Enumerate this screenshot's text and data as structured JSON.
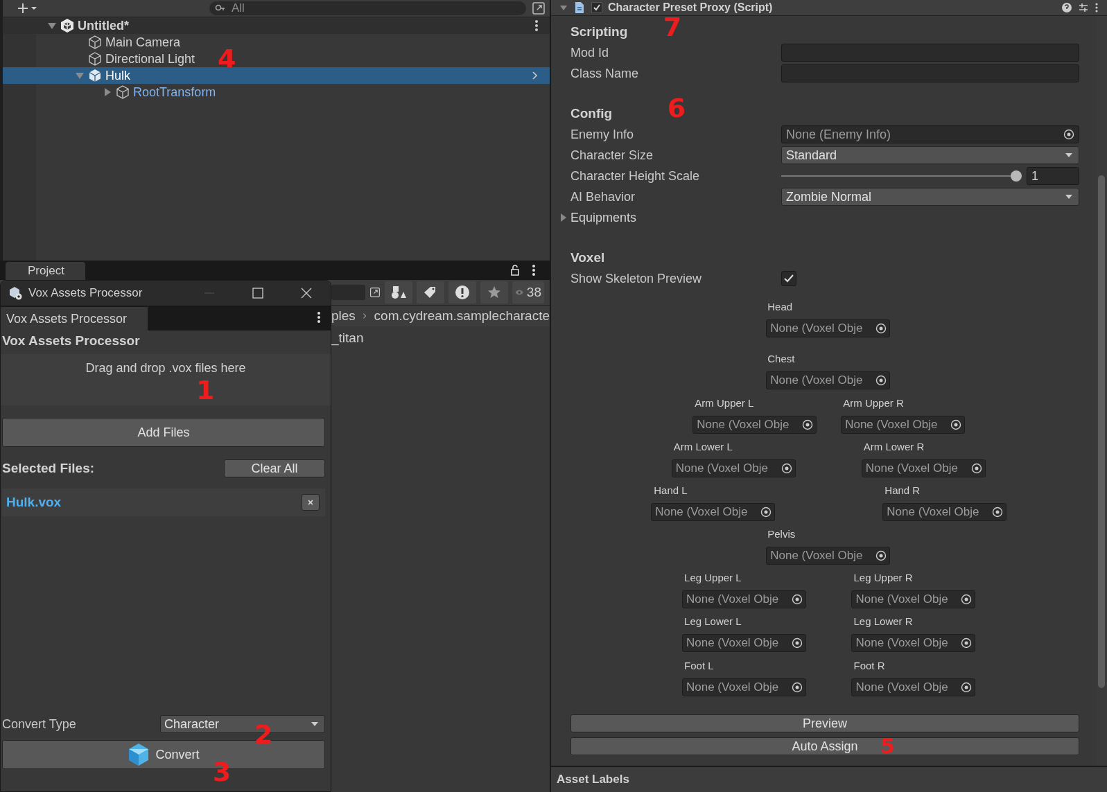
{
  "hierarchy": {
    "search": {
      "placeholder": "All"
    },
    "items": [
      {
        "label": "Untitled*",
        "kind": "scene",
        "expanded": true,
        "selected": false,
        "children": [
          {
            "label": "Main Camera",
            "kind": "object",
            "selected": false
          },
          {
            "label": "Directional Light",
            "kind": "object",
            "selected": false
          },
          {
            "label": "Hulk",
            "kind": "prefab",
            "expanded": true,
            "selected": true,
            "children": [
              {
                "label": "RootTransform",
                "kind": "prefab",
                "expanded": false,
                "selected": false
              }
            ]
          }
        ]
      }
    ]
  },
  "project": {
    "tab": "Project",
    "visible_count": "38",
    "breadcrumb": [
      "ples",
      "com.cydream.samplecharacte"
    ],
    "items": [
      "_titan"
    ]
  },
  "vox_window": {
    "title": "Vox Assets Processor",
    "tab": "Vox Assets Processor",
    "heading": "Vox Assets Processor",
    "drop_hint": "Drag and drop .vox files here",
    "add_button": "Add Files",
    "selected_label": "Selected Files:",
    "clear_button": "Clear All",
    "files": [
      "Hulk.vox"
    ],
    "convert_type": {
      "label": "Convert Type",
      "value": "Character"
    },
    "convert_button": "Convert"
  },
  "inspector": {
    "component": {
      "title": "Character Preset Proxy (Script)",
      "enabled": true
    },
    "sections": [
      {
        "title": "Scripting",
        "rows": [
          {
            "kind": "text",
            "label": "Mod Id"
          },
          {
            "kind": "text",
            "label": "Class Name"
          }
        ]
      },
      {
        "title": "Config",
        "rows": [
          {
            "kind": "object",
            "label": "Enemy Info",
            "value": "None (Enemy Info)"
          },
          {
            "kind": "dropdown",
            "label": "Character Size",
            "value": "Standard"
          },
          {
            "kind": "slider",
            "label": "Character Height Scale",
            "value": "1",
            "level": 0.98
          },
          {
            "kind": "dropdown",
            "label": "AI Behavior",
            "value": "Zombie Normal"
          },
          {
            "kind": "foldout",
            "label": "Equipments",
            "expanded": false
          }
        ]
      },
      {
        "title": "Voxel",
        "rows": [
          {
            "kind": "checkbox",
            "label": "Show Skeleton Preview",
            "checked": true
          }
        ]
      }
    ],
    "bones": [
      {
        "label": "Head",
        "value": "None (Voxel Obje"
      },
      {
        "label": "Chest",
        "value": "None (Voxel Obje"
      },
      {
        "label": "Arm Upper L",
        "value": "None (Voxel Obje"
      },
      {
        "label": "Arm Upper R",
        "value": "None (Voxel Obje"
      },
      {
        "label": "Arm Lower L",
        "value": "None (Voxel Obje"
      },
      {
        "label": "Arm Lower R",
        "value": "None (Voxel Obje"
      },
      {
        "label": "Hand L",
        "value": "None (Voxel Obje"
      },
      {
        "label": "Hand R",
        "value": "None (Voxel Obje"
      },
      {
        "label": "Pelvis",
        "value": "None (Voxel Obje"
      },
      {
        "label": "Leg Upper L",
        "value": "None (Voxel Obje"
      },
      {
        "label": "Leg Upper R",
        "value": "None (Voxel Obje"
      },
      {
        "label": "Leg Lower L",
        "value": "None (Voxel Obje"
      },
      {
        "label": "Leg Lower R",
        "value": "None (Voxel Obje"
      },
      {
        "label": "Foot L",
        "value": "None (Voxel Obje"
      },
      {
        "label": "Foot R",
        "value": "None (Voxel Obje"
      }
    ],
    "buttons": [
      "Preview",
      "Auto Assign"
    ],
    "footer": "Asset Labels"
  },
  "annotations": [
    "1",
    "2",
    "3",
    "4",
    "5",
    "6",
    "7"
  ]
}
